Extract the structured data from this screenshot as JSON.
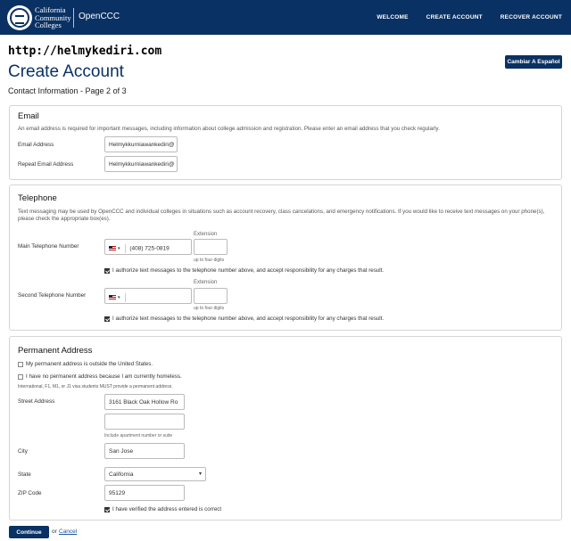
{
  "nav": {
    "brand_line1": "California",
    "brand_line2": "Community",
    "brand_line3": "Colleges",
    "app_name": "OpenCCC",
    "links": [
      "WELCOME",
      "CREATE ACCOUNT",
      "RECOVER ACCOUNT"
    ]
  },
  "watermark": "http://helmykediri.com",
  "page": {
    "title": "Create Account",
    "subtitle": "Contact Information - Page 2 of 3",
    "lang_button": "Cambiar A Español"
  },
  "email": {
    "heading": "Email",
    "description": "An email address is required for important messages, including information about college admission and registration. Please enter an email address that you check regularly.",
    "email_label": "Email Address",
    "email_value": "Helmykkurniawankediri@",
    "repeat_label": "Repeat Email Address",
    "repeat_value": "Helmykkurniawankediri@"
  },
  "telephone": {
    "heading": "Telephone",
    "description": "Text messaging may be used by OpenCCC and individual colleges in situations such as account recovery, class cancelations, and emergency notifications. If you would like to receive text messages on your phone(s), please check the appropriate box(es).",
    "extension_label": "Extension",
    "extension_hint": "up to four digits",
    "main_label": "Main Telephone Number",
    "main_value": "(408) 725-0819",
    "main_authorize": "I authorize text messages to the telephone number above, and accept responsibility for any charges that result.",
    "second_label": "Second Telephone Number",
    "second_value": "",
    "second_authorize": "I authorize text messages to the telephone number above, and accept responsibility for any charges that result."
  },
  "address": {
    "heading": "Permanent Address",
    "outside_us": "My permanent address is outside the United States.",
    "homeless": "I have no permanent address because I am currently homeless.",
    "visa_note": "International, F1, M1, or J1 visa students MUST provide a permanent address.",
    "street_label": "Street Address",
    "street_value": "3161  Black Oak Hollow Ro",
    "street2_value": "",
    "street2_hint": "Include apartment number or suite",
    "city_label": "City",
    "city_value": "San Jose",
    "state_label": "State",
    "state_value": "California",
    "zip_label": "ZIP Code",
    "zip_value": "95129",
    "verified": "I have verified the address entered is correct"
  },
  "footer": {
    "continue": "Continue",
    "or": "or",
    "cancel": "Cancel"
  },
  "colors": {
    "primary": "#0a3163",
    "link": "#1a55a8"
  }
}
